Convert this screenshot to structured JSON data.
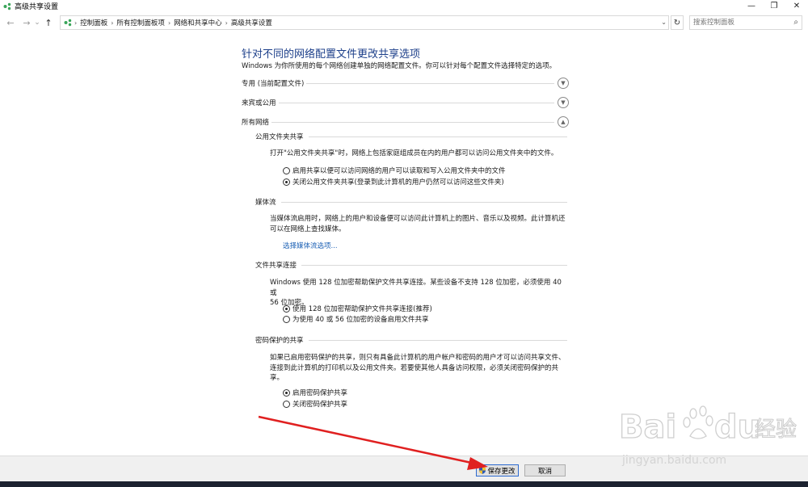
{
  "window": {
    "title": "高级共享设置",
    "controls": {
      "minimize": "—",
      "maximize": "❐",
      "close": "✕"
    }
  },
  "nav": {
    "back": "←",
    "forward": "→",
    "recent": "⌄",
    "up": "↑",
    "breadcrumbs": [
      "控制面板",
      "所有控制面板项",
      "网络和共享中心",
      "高级共享设置"
    ],
    "refresh": "↻",
    "search_placeholder": "搜索控制面板"
  },
  "page": {
    "title": "针对不同的网络配置文件更改共享选项",
    "description": "Windows 为你所使用的每个网络创建单独的网络配置文件。你可以针对每个配置文件选择特定的选项。"
  },
  "profiles": [
    {
      "label": "专用 (当前配置文件)",
      "expanded": false
    },
    {
      "label": "来宾或公用",
      "expanded": false
    },
    {
      "label": "所有网络",
      "expanded": true
    }
  ],
  "sections": {
    "public_folder": {
      "title": "公用文件夹共享",
      "desc": "打开\"公用文件夹共享\"时，网络上包括家庭组成员在内的用户都可以访问公用文件夹中的文件。",
      "options": [
        {
          "label": "启用共享以便可以访问网络的用户可以读取和写入公用文件夹中的文件",
          "checked": false
        },
        {
          "label": "关闭公用文件夹共享(登录到此计算机的用户仍然可以访问这些文件夹)",
          "checked": true
        }
      ]
    },
    "media": {
      "title": "媒体流",
      "desc_line1": "当媒体流启用时，网络上的用户和设备便可以访问此计算机上的图片、音乐以及视频。此计算机还",
      "desc_line2": "可以在网络上查找媒体。",
      "link": "选择媒体流选项..."
    },
    "file_sharing": {
      "title": "文件共享连接",
      "desc_line1": "Windows 使用 128 位加密帮助保护文件共享连接。某些设备不支持 128 位加密，必须使用 40 或",
      "desc_line2": "56 位加密。",
      "options": [
        {
          "label": "使用 128 位加密帮助保护文件共享连接(推荐)",
          "checked": true
        },
        {
          "label": "为使用 40 或 56 位加密的设备启用文件共享",
          "checked": false
        }
      ]
    },
    "password": {
      "title": "密码保护的共享",
      "desc_line1": "如果已启用密码保护的共享，则只有具备此计算机的用户帐户和密码的用户才可以访问共享文件、",
      "desc_line2": "连接到此计算机的打印机以及公用文件夹。若要使其他人具备访问权限，必须关闭密码保护的共享。",
      "options": [
        {
          "label": "启用密码保护共享",
          "checked": true
        },
        {
          "label": "关闭密码保护共享",
          "checked": false
        }
      ]
    }
  },
  "footer": {
    "save": "保存更改",
    "cancel": "取消"
  },
  "watermark": {
    "brand": "Bai",
    "brand_suffix": "du",
    "cn": "经验",
    "url": "jingyan.baidu.com"
  },
  "colors": {
    "title": "#1c3f8a",
    "link": "#1a5fb4",
    "arrow": "#e02020"
  }
}
